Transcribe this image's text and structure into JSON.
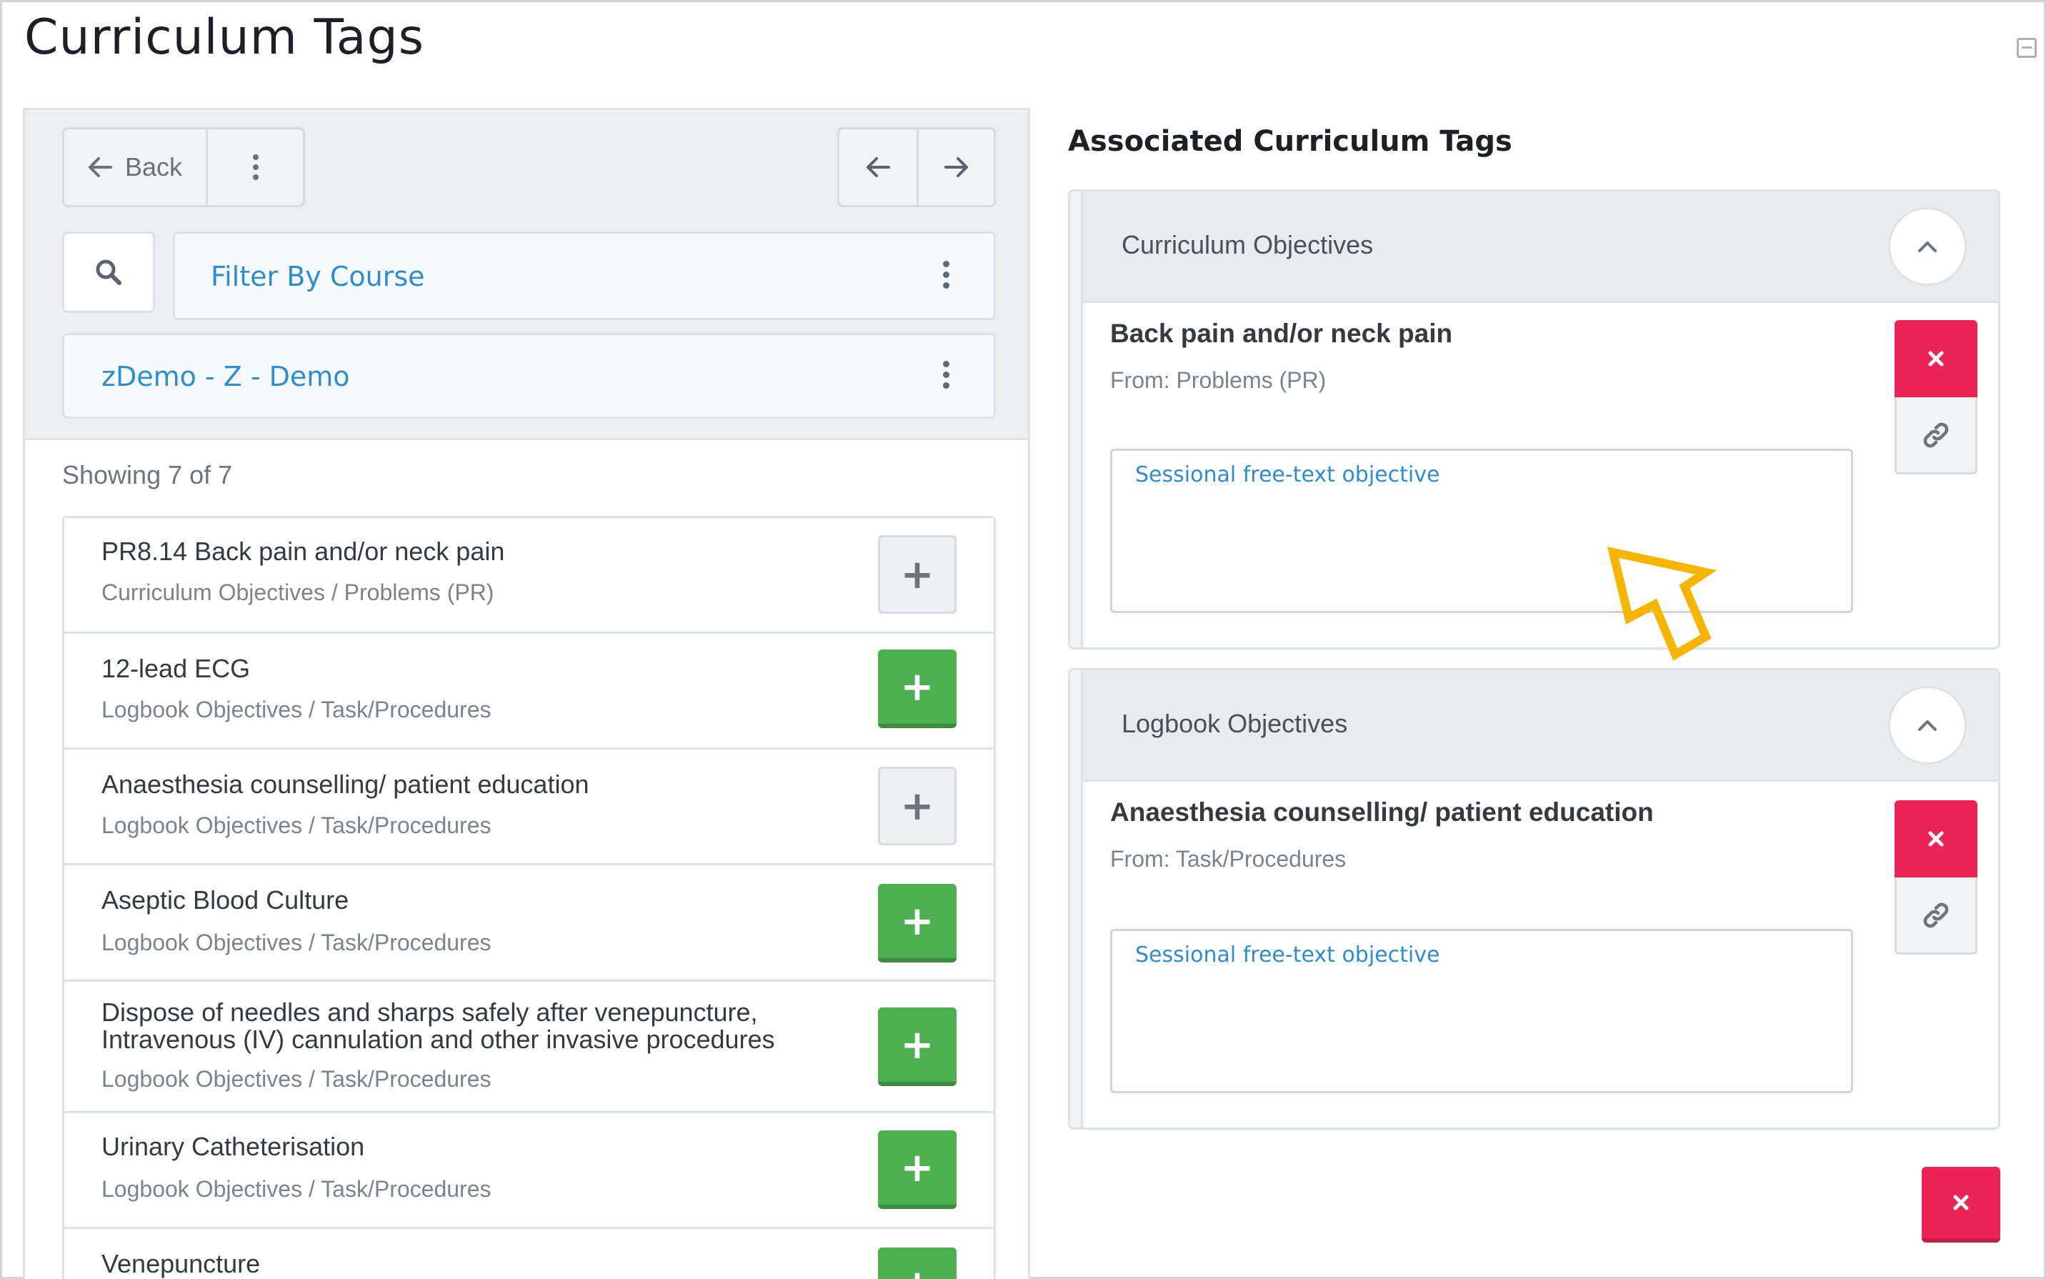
{
  "page": {
    "title": "Curriculum Tags"
  },
  "left": {
    "back_label": "Back",
    "filter_label": "Filter By Course",
    "course_label": "zDemo - Z - Demo",
    "showing": "Showing 7 of 7",
    "items": [
      {
        "name": "PR8.14 Back pain and/or neck pain",
        "path": "Curriculum Objectives / Problems (PR)",
        "state": "added"
      },
      {
        "name": "12-lead ECG",
        "path": "Logbook Objectives / Task/Procedures",
        "state": "available"
      },
      {
        "name": "Anaesthesia counselling/ patient education",
        "path": "Logbook Objectives / Task/Procedures",
        "state": "added"
      },
      {
        "name": "Aseptic Blood Culture",
        "path": "Logbook Objectives / Task/Procedures",
        "state": "available"
      },
      {
        "name": "Dispose of needles and sharps safely after venepuncture,\nIntravenous (IV) cannulation and other invasive procedures",
        "path": "Logbook Objectives / Task/Procedures",
        "state": "available"
      },
      {
        "name": "Urinary Catheterisation",
        "path": "Logbook Objectives / Task/Procedures",
        "state": "available"
      },
      {
        "name": "Venepuncture",
        "path": "",
        "state": "available"
      }
    ],
    "add_symbol": "+"
  },
  "right": {
    "title": "Associated Curriculum Tags",
    "sections": [
      {
        "title": "Curriculum Objectives",
        "objective_title": "Back pain and/or neck pain",
        "objective_from": "From: Problems (PR)",
        "placeholder": "Sessional free-text objective"
      },
      {
        "title": "Logbook Objectives",
        "objective_title": "Anaesthesia counselling/ patient education",
        "objective_from": "From: Task/Procedures",
        "placeholder": "Sessional free-text objective"
      }
    ]
  },
  "colors": {
    "accent": "#2c8ed1",
    "add_green": "#4caf50",
    "remove_red": "#ec2456",
    "annotation_arrow": "#f7b500"
  }
}
